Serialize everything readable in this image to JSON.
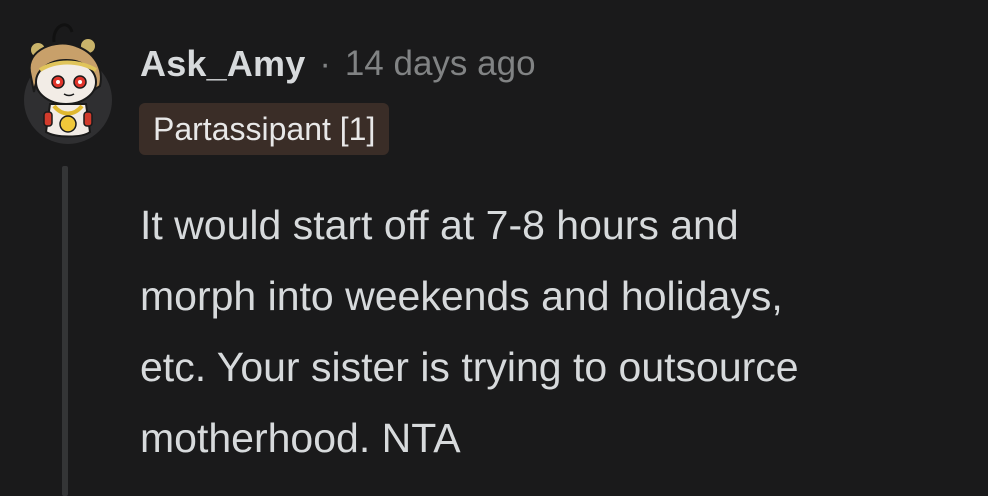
{
  "comment": {
    "author": "Ask_Amy",
    "separator": "·",
    "timestamp": "14 days ago",
    "flair": "Partassipant [1]",
    "body_lines": [
      "It would start off at 7-8 hours and",
      "morph into weekends and holidays,",
      "etc. Your sister is trying to outsource",
      "motherhood. NTA"
    ],
    "avatar": {
      "icon": "snoo-avatar-icon"
    }
  }
}
